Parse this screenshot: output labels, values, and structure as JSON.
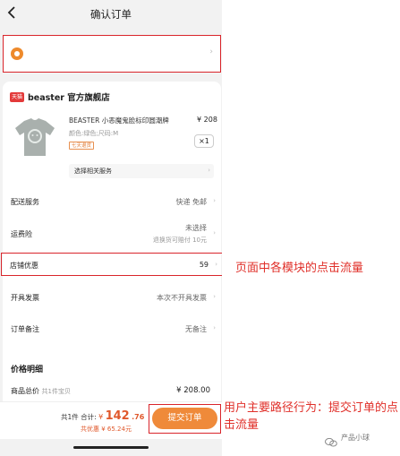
{
  "nav": {
    "back_icon": "chevron-left-icon",
    "title": "确认订单"
  },
  "address": {
    "icon": "location-icon"
  },
  "shop": {
    "logo_text": "天猫",
    "name": "beaster 官方旗舰店",
    "product": {
      "name": "BEASTER 小恶魔鬼脸标印圆潮牌",
      "price": "¥ 208",
      "spec": "颜色:绿色;尺码:M",
      "tag": "七天退货",
      "quantity": "×1"
    },
    "service_label": "选择相关服务"
  },
  "rows": {
    "delivery": {
      "label": "配送服务",
      "value": "快递 免邮"
    },
    "insurance": {
      "label": "运费险",
      "value": "未选择",
      "subvalue": "退换货可赔付 10元"
    },
    "shop_discount": {
      "label": "店铺优惠",
      "value": "59"
    },
    "invoice": {
      "label": "开具发票",
      "value": "本次不开具发票"
    },
    "remark": {
      "label": "订单备注",
      "value": "无备注"
    }
  },
  "price_detail": {
    "title": "价格明细",
    "total_label": "商品总价",
    "total_sub": "共1件宝贝",
    "total_value": "¥ 208.00"
  },
  "bottom": {
    "count_text": "共1件",
    "total_label": "合计:",
    "yen": "¥",
    "amount_int": "142",
    "amount_dec": ".76",
    "discount_text": "共优惠 ¥ 65.24元",
    "submit": "提交订单"
  },
  "annotations": {
    "module_clicks": "页面中各模块的点击流量",
    "main_path": "用户主要路径行为：提交订单的点击流量"
  },
  "watermark": {
    "text": "产品小球"
  },
  "colors": {
    "accent": "#ef8a3a",
    "highlight": "#d9252b",
    "annotation": "#e0302a",
    "price": "#e0582b"
  }
}
